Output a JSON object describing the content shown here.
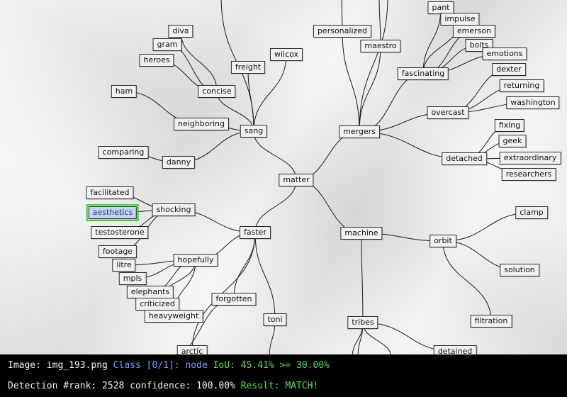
{
  "colors": {
    "edge": "#1a1a1a",
    "highlight": "#35d535",
    "status_white": "#f2f2f2",
    "status_blue": "#7d9cff",
    "status_green": "#52e052"
  },
  "mindmap": {
    "nodes": [
      {
        "id": "matter",
        "label": "matter"
      },
      {
        "id": "sang",
        "label": "sang"
      },
      {
        "id": "faster",
        "label": "faster"
      },
      {
        "id": "mergers",
        "label": "mergers"
      },
      {
        "id": "machine",
        "label": "machine"
      },
      {
        "id": "personalized",
        "label": "personalized"
      },
      {
        "id": "maestro",
        "label": "maestro"
      },
      {
        "id": "fascinating",
        "label": "fascinating"
      },
      {
        "id": "pant",
        "label": "pant"
      },
      {
        "id": "impulse",
        "label": "impulse"
      },
      {
        "id": "emerson",
        "label": "emerson"
      },
      {
        "id": "bolts",
        "label": "bolts"
      },
      {
        "id": "emotions",
        "label": "emotions"
      },
      {
        "id": "overcast",
        "label": "overcast"
      },
      {
        "id": "dexter",
        "label": "dexter"
      },
      {
        "id": "returning",
        "label": "returning"
      },
      {
        "id": "washington",
        "label": "washington"
      },
      {
        "id": "detached",
        "label": "detached"
      },
      {
        "id": "fixing",
        "label": "fixing"
      },
      {
        "id": "geek",
        "label": "geek"
      },
      {
        "id": "extraordinary",
        "label": "extraordinary"
      },
      {
        "id": "researchers",
        "label": "researchers"
      },
      {
        "id": "freight",
        "label": "freight"
      },
      {
        "id": "wilcox",
        "label": "wilcox"
      },
      {
        "id": "concise",
        "label": "concise"
      },
      {
        "id": "diva",
        "label": "diva"
      },
      {
        "id": "gram",
        "label": "gram"
      },
      {
        "id": "heroes",
        "label": "heroes"
      },
      {
        "id": "neighboring",
        "label": "neighboring"
      },
      {
        "id": "ham",
        "label": "ham"
      },
      {
        "id": "danny",
        "label": "danny"
      },
      {
        "id": "comparing",
        "label": "comparing"
      },
      {
        "id": "shocking",
        "label": "shocking"
      },
      {
        "id": "facilitated",
        "label": "facilitated"
      },
      {
        "id": "aesthetics",
        "label": "aesthetics",
        "detected": true
      },
      {
        "id": "testosterone",
        "label": "testosterone"
      },
      {
        "id": "hopefully",
        "label": "hopefully"
      },
      {
        "id": "footage",
        "label": "footage"
      },
      {
        "id": "litre",
        "label": "litre"
      },
      {
        "id": "mpls",
        "label": "mpls"
      },
      {
        "id": "elephants",
        "label": "elephants"
      },
      {
        "id": "criticized",
        "label": "criticized"
      },
      {
        "id": "heavyweight",
        "label": "heavyweight"
      },
      {
        "id": "forgotten",
        "label": "forgotten"
      },
      {
        "id": "arctic",
        "label": "arctic"
      },
      {
        "id": "toni",
        "label": "toni"
      },
      {
        "id": "orbit",
        "label": "orbit"
      },
      {
        "id": "clamp",
        "label": "clamp"
      },
      {
        "id": "solution",
        "label": "solution"
      },
      {
        "id": "filtration",
        "label": "filtration"
      },
      {
        "id": "tribes",
        "label": "tribes"
      },
      {
        "id": "detained",
        "label": "detained"
      }
    ],
    "edges": [
      [
        "matter",
        "sang"
      ],
      [
        "matter",
        "faster"
      ],
      [
        "matter",
        "mergers"
      ],
      [
        "matter",
        "machine"
      ],
      [
        "sang",
        "freight"
      ],
      [
        "sang",
        "wilcox"
      ],
      [
        "sang",
        "concise"
      ],
      [
        "sang",
        "neighboring"
      ],
      [
        "sang",
        "danny"
      ],
      [
        "sang",
        "top-a"
      ],
      [
        "concise",
        "diva"
      ],
      [
        "concise",
        "gram"
      ],
      [
        "concise",
        "heroes"
      ],
      [
        "neighboring",
        "ham"
      ],
      [
        "danny",
        "comparing"
      ],
      [
        "mergers",
        "personalized"
      ],
      [
        "mergers",
        "maestro"
      ],
      [
        "mergers",
        "fascinating"
      ],
      [
        "mergers",
        "overcast"
      ],
      [
        "mergers",
        "detached"
      ],
      [
        "mergers",
        "top-b"
      ],
      [
        "personalized",
        "top-c"
      ],
      [
        "maestro",
        "top-d"
      ],
      [
        "fascinating",
        "pant"
      ],
      [
        "fascinating",
        "impulse"
      ],
      [
        "fascinating",
        "emerson"
      ],
      [
        "fascinating",
        "bolts"
      ],
      [
        "fascinating",
        "emotions"
      ],
      [
        "overcast",
        "dexter"
      ],
      [
        "overcast",
        "returning"
      ],
      [
        "overcast",
        "washington"
      ],
      [
        "detached",
        "fixing"
      ],
      [
        "detached",
        "geek"
      ],
      [
        "detached",
        "extraordinary"
      ],
      [
        "detached",
        "researchers"
      ],
      [
        "faster",
        "shocking"
      ],
      [
        "faster",
        "hopefully"
      ],
      [
        "faster",
        "forgotten"
      ],
      [
        "faster",
        "toni"
      ],
      [
        "faster",
        "arctic"
      ],
      [
        "shocking",
        "facilitated"
      ],
      [
        "shocking",
        "aesthetics"
      ],
      [
        "shocking",
        "testosterone"
      ],
      [
        "shocking",
        "footage"
      ],
      [
        "hopefully",
        "litre"
      ],
      [
        "hopefully",
        "mpls"
      ],
      [
        "hopefully",
        "elephants"
      ],
      [
        "hopefully",
        "criticized"
      ],
      [
        "hopefully",
        "heavyweight"
      ],
      [
        "forgotten",
        "bottom-a"
      ],
      [
        "toni",
        "bottom-b"
      ],
      [
        "machine",
        "orbit"
      ],
      [
        "machine",
        "tribes"
      ],
      [
        "orbit",
        "clamp"
      ],
      [
        "orbit",
        "solution"
      ],
      [
        "orbit",
        "filtration"
      ],
      [
        "tribes",
        "detained"
      ],
      [
        "tribes",
        "bottom-c"
      ],
      [
        "tribes",
        "bottom-d"
      ],
      [
        "tribes",
        "bottom-e"
      ]
    ]
  },
  "status": {
    "line1_prefix": "Image: img_193.png ",
    "line1_class": "Class [0/1]: node ",
    "line1_iou": "IoU: 45.41% >= 30.00%",
    "line2_prefix": "Detection #rank: 2528 confidence: 100.00% ",
    "line2_result": "Result: MATCH!"
  }
}
